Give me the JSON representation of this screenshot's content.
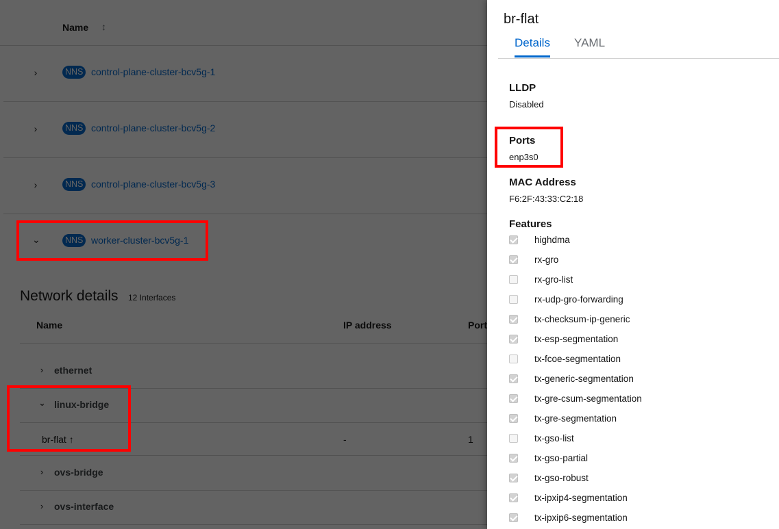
{
  "nns_table": {
    "header": {
      "name": "Name",
      "sort_icon": "sort-icon"
    },
    "badge": "NNS",
    "rows": [
      {
        "name": "control-plane-cluster-bcv5g-1",
        "expanded": false
      },
      {
        "name": "control-plane-cluster-bcv5g-2",
        "expanded": false
      },
      {
        "name": "control-plane-cluster-bcv5g-3",
        "expanded": false
      },
      {
        "name": "worker-cluster-bcv5g-1",
        "expanded": true
      }
    ]
  },
  "network": {
    "title": "Network details",
    "count": "12 Interfaces",
    "columns": {
      "name": "Name",
      "ip": "IP address",
      "port": "Port"
    },
    "types": {
      "ethernet": "ethernet",
      "linux_bridge": "linux-bridge",
      "ovs_bridge": "ovs-bridge",
      "ovs_interface": "ovs-interface"
    },
    "iface": {
      "name": "br-flat",
      "icon": "up-arrow-icon",
      "ip": "-",
      "port": "1"
    }
  },
  "drawer": {
    "title": "br-flat",
    "tabs": [
      "Details",
      "YAML"
    ],
    "active_tab": "Details",
    "lldp": {
      "label": "LLDP",
      "value": "Disabled"
    },
    "ports": {
      "label": "Ports",
      "value": "enp3s0"
    },
    "mac": {
      "label": "MAC Address",
      "value": "F6:2F:43:33:C2:18"
    },
    "features": {
      "label": "Features",
      "items": [
        {
          "name": "highdma",
          "checked": true
        },
        {
          "name": "rx-gro",
          "checked": true
        },
        {
          "name": "rx-gro-list",
          "checked": false
        },
        {
          "name": "rx-udp-gro-forwarding",
          "checked": false
        },
        {
          "name": "tx-checksum-ip-generic",
          "checked": true
        },
        {
          "name": "tx-esp-segmentation",
          "checked": true
        },
        {
          "name": "tx-fcoe-segmentation",
          "checked": false
        },
        {
          "name": "tx-generic-segmentation",
          "checked": true
        },
        {
          "name": "tx-gre-csum-segmentation",
          "checked": true
        },
        {
          "name": "tx-gre-segmentation",
          "checked": true
        },
        {
          "name": "tx-gso-list",
          "checked": false
        },
        {
          "name": "tx-gso-partial",
          "checked": true
        },
        {
          "name": "tx-gso-robust",
          "checked": true
        },
        {
          "name": "tx-ipxip4-segmentation",
          "checked": true
        },
        {
          "name": "tx-ipxip6-segmentation",
          "checked": true
        }
      ]
    }
  },
  "colors": {
    "accent": "#0066cc",
    "highlight": "#ff0000",
    "overlay": "#030303"
  }
}
